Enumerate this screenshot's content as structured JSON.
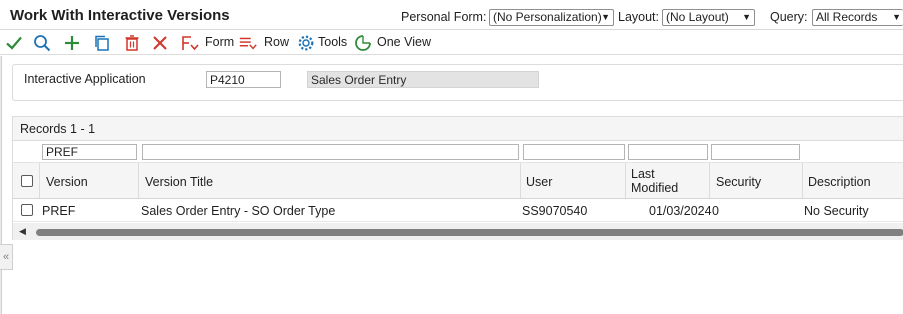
{
  "header": {
    "title": "Work With Interactive Versions",
    "personal_form_label": "Personal Form:",
    "personal_form_value": "(No Personalization)",
    "layout_label": "Layout:",
    "layout_value": "(No Layout)",
    "query_label": "Query:",
    "query_value": "All Records"
  },
  "toolbar": {
    "icons": [
      "check-icon",
      "search-icon",
      "plus-icon",
      "copy-icon",
      "trash-icon",
      "close-icon"
    ],
    "form_label": "Form",
    "row_label": "Row",
    "tools_label": "Tools",
    "one_view_label": "One View",
    "colors": {
      "check": "#2e8b3a",
      "search": "#1a73b8",
      "add": "#2e8b3a",
      "delete": "#d0362a",
      "menu": "#d0362a"
    }
  },
  "form": {
    "app_label": "Interactive Application",
    "app_value": "P4210",
    "app_description": "Sales Order Entry"
  },
  "grid": {
    "caption": "Records 1 - 1",
    "qbe": {
      "version": "PREF",
      "title": "",
      "user": "",
      "last_modified": "",
      "security": ""
    },
    "columns": {
      "version": "Version",
      "title": "Version Title",
      "user": "User",
      "last_modified_1": "Last",
      "last_modified_2": "Modified",
      "security": "Security",
      "description": "Description"
    },
    "rows": [
      {
        "version": "PREF",
        "title": "Sales Order Entry - SO Order Type",
        "user": "SS9070540",
        "last_modified": "01/03/2024",
        "security": "0",
        "description": "No Security"
      }
    ]
  },
  "collapse_glyph": "«"
}
